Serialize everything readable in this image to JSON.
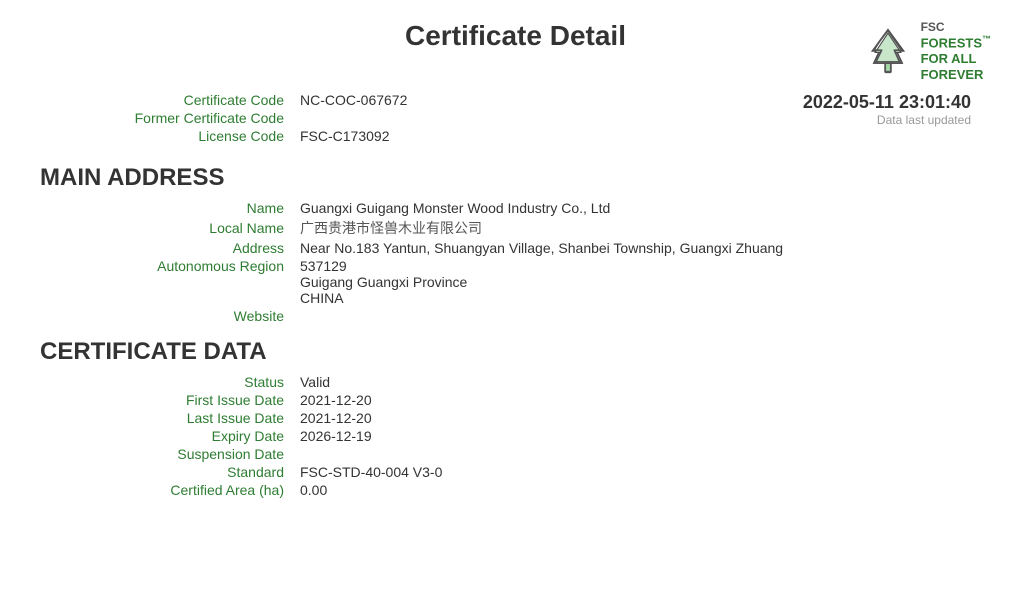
{
  "page": {
    "title": "Certificate Detail"
  },
  "fsc": {
    "label": "FSC",
    "tagline_line1": "FORESTS",
    "tagline_line2": "FOR ALL",
    "tagline_line3": "FOREVER",
    "tm": "™"
  },
  "certificate_info": {
    "certificate_code_label": "Certificate Code",
    "certificate_code_value": "NC-COC-067672",
    "former_certificate_code_label": "Former Certificate Code",
    "former_certificate_code_value": "",
    "license_code_label": "License Code",
    "license_code_value": "FSC-C173092"
  },
  "timestamp": {
    "value": "2022-05-11 23:01:40",
    "label": "Data last updated"
  },
  "main_address": {
    "heading": "MAIN ADDRESS",
    "name_label": "Name",
    "name_value": "Guangxi Guigang Monster Wood Industry Co., Ltd",
    "local_name_label": "Local Name",
    "local_name_value": "广西贵港市怪兽木业有限公司",
    "address_label": "Address",
    "address_value": "Near No.183 Yantun, Shuangyan Village, Shanbei Township, Guangxi Zhuang",
    "autonomous_region_label": "Autonomous Region",
    "postal_code": "537129",
    "city_province": "Guigang  Guangxi Province",
    "country": "CHINA",
    "website_label": "Website",
    "website_value": ""
  },
  "certificate_data": {
    "heading": "CERTIFICATE DATA",
    "status_label": "Status",
    "status_value": "Valid",
    "first_issue_date_label": "First Issue Date",
    "first_issue_date_value": "2021-12-20",
    "last_issue_date_label": "Last Issue Date",
    "last_issue_date_value": "2021-12-20",
    "expiry_date_label": "Expiry Date",
    "expiry_date_value": "2026-12-19",
    "suspension_date_label": "Suspension Date",
    "suspension_date_value": "",
    "standard_label": "Standard",
    "standard_value": "FSC-STD-40-004 V3-0",
    "certified_area_label": "Certified Area (ha)",
    "certified_area_value": "0.00"
  }
}
